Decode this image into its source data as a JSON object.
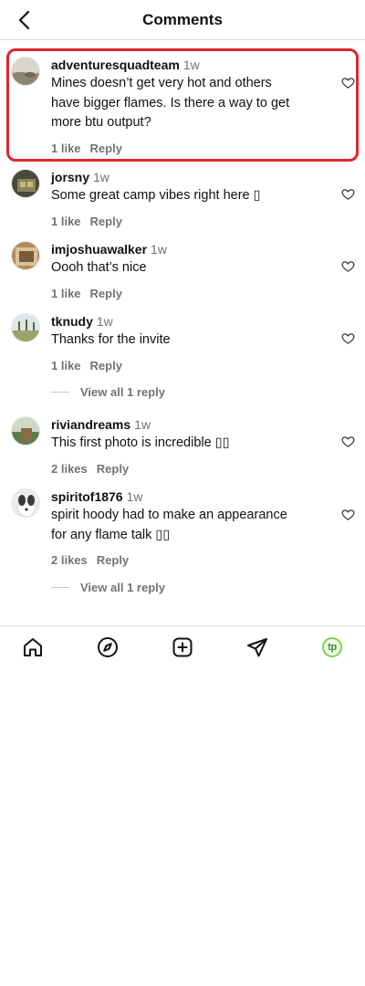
{
  "header": {
    "title": "Comments",
    "back_icon": "chevron-left-icon"
  },
  "comments": [
    {
      "username": "adventuresquadteam",
      "time": "1w",
      "text_lines": [
        "Mines doesn’t get very hot and others",
        "have bigger flames. Is there a way to get",
        "more btu output?"
      ],
      "likes": "1 like",
      "reply": "Reply"
    },
    {
      "username": "jorsny",
      "time": "1w",
      "text_lines": [
        "Some great camp vibes right here ▯"
      ],
      "likes": "1 like",
      "reply": "Reply"
    },
    {
      "username": "imjoshuawalker",
      "time": "1w",
      "text_lines": [
        "Oooh that’s nice"
      ],
      "likes": "1 like",
      "reply": "Reply"
    },
    {
      "username": "tknudy",
      "time": "1w",
      "text_lines": [
        "Thanks for the invite"
      ],
      "likes": "1 like",
      "reply": "Reply",
      "view_replies": "View all 1 reply"
    },
    {
      "username": "riviandreams",
      "time": "1w",
      "text_lines": [
        "This first photo is incredible ▯▯"
      ],
      "likes": "2 likes",
      "reply": "Reply"
    },
    {
      "username": "spiritof1876",
      "time": "1w",
      "text_lines": [
        "spirit hoody had to make an appearance",
        "for any flame talk ▯▯"
      ],
      "likes": "2 likes",
      "reply": "Reply",
      "view_replies": "View all 1 reply"
    }
  ],
  "navbar": {
    "items": [
      "home-icon",
      "explore-compass-icon",
      "create-post-icon",
      "direct-message-icon",
      "profile-avatar"
    ],
    "profile_initials": "tp",
    "profile_ring_color": "#7bd34b"
  },
  "colors": {
    "highlight": "#e0242f",
    "secondary_text": "#737373"
  }
}
